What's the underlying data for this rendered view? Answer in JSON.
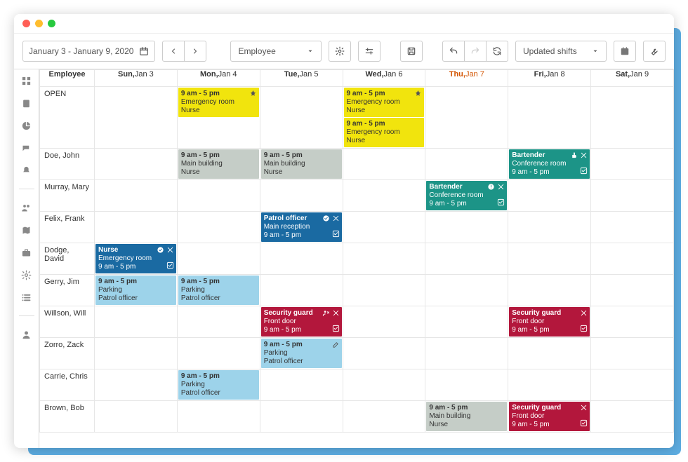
{
  "toolbar": {
    "date_range": "January 3 - January 9, 2020",
    "group_by": "Employee",
    "filter": "Updated shifts"
  },
  "header": {
    "employee_col": "Employee",
    "days": [
      {
        "dow": "Sun,",
        "date": "Jan 3"
      },
      {
        "dow": "Mon,",
        "date": "Jan 4"
      },
      {
        "dow": "Tue,",
        "date": "Jan 5"
      },
      {
        "dow": "Wed,",
        "date": "Jan 6"
      },
      {
        "dow": "Thu,",
        "date": "Jan 7",
        "today": true
      },
      {
        "dow": "Fri,",
        "date": "Jan 8"
      },
      {
        "dow": "Sat,",
        "date": "Jan 9"
      }
    ]
  },
  "rows": [
    {
      "name": "OPEN",
      "cells": [
        [],
        [
          {
            "t1": "9 am - 5 pm",
            "t2": "Emergency room",
            "t3": "Nurse",
            "color": "yellow",
            "icons": [
              "pin"
            ]
          }
        ],
        [],
        [
          {
            "t1": "9 am - 5 pm",
            "t2": "Emergency room",
            "t3": "Nurse",
            "color": "yellow",
            "icons": [
              "pin"
            ]
          },
          {
            "t1": "9 am - 5 pm",
            "t2": "Emergency room",
            "t3": "Nurse",
            "color": "yellow"
          }
        ],
        [],
        [],
        []
      ]
    },
    {
      "name": "Doe, John",
      "cells": [
        [],
        [
          {
            "t1": "9 am - 5 pm",
            "t2": "Main building",
            "t3": "Nurse",
            "color": "gray"
          }
        ],
        [
          {
            "t1": "9 am - 5 pm",
            "t2": "Main building",
            "t3": "Nurse",
            "color": "gray"
          }
        ],
        [],
        [],
        [
          {
            "t1": "Bartender",
            "t2": "Conference room",
            "t3": "9 am - 5 pm",
            "color": "teal",
            "icons": [
              "thumb",
              "close"
            ],
            "corner": "check"
          }
        ],
        []
      ]
    },
    {
      "name": "Murray, Mary",
      "cells": [
        [],
        [],
        [],
        [],
        [
          {
            "t1": "Bartender",
            "t2": "Conference room",
            "t3": "9 am - 5 pm",
            "color": "teal",
            "icons": [
              "alert",
              "close"
            ],
            "corner": "check"
          }
        ],
        [],
        []
      ]
    },
    {
      "name": "Felix, Frank",
      "cells": [
        [],
        [],
        [
          {
            "t1": "Patrol officer",
            "t2": "Main reception",
            "t3": "9 am - 5 pm",
            "color": "navy",
            "icons": [
              "okcircle",
              "close"
            ],
            "corner": "check"
          }
        ],
        [],
        [],
        [],
        []
      ]
    },
    {
      "name": "Dodge, David",
      "cells": [
        [
          {
            "t1": "Nurse",
            "t2": "Emergency room",
            "t3": "9 am - 5 pm",
            "color": "navy",
            "icons": [
              "okcircle",
              "close"
            ],
            "corner": "check"
          }
        ],
        [],
        [],
        [],
        [],
        [],
        []
      ]
    },
    {
      "name": "Gerry, Jim",
      "cells": [
        [
          {
            "t1": "9 am - 5 pm",
            "t2": "Parking",
            "t3": "Patrol officer",
            "color": "blue"
          }
        ],
        [
          {
            "t1": "9 am - 5 pm",
            "t2": "Parking",
            "t3": "Patrol officer",
            "color": "blue"
          }
        ],
        [],
        [],
        [],
        [],
        []
      ]
    },
    {
      "name": "Willson, Will",
      "cells": [
        [],
        [],
        [
          {
            "t1": "Security guard",
            "t2": "Front door",
            "t3": "9 am - 5 pm",
            "color": "red",
            "icons": [
              "userx",
              "close"
            ],
            "corner": "check"
          }
        ],
        [],
        [],
        [
          {
            "t1": "Security guard",
            "t2": "Front door",
            "t3": "9 am - 5 pm",
            "color": "red",
            "icons": [
              "close"
            ],
            "corner": "check"
          }
        ],
        []
      ]
    },
    {
      "name": "Zorro, Zack",
      "cells": [
        [],
        [],
        [
          {
            "t1": "9 am - 5 pm",
            "t2": "Parking",
            "t3": "Patrol officer",
            "color": "blue",
            "icons": [
              "edit"
            ]
          }
        ],
        [],
        [],
        [],
        []
      ]
    },
    {
      "name": "Carrie, Chris",
      "cells": [
        [],
        [
          {
            "t1": "9 am - 5 pm",
            "t2": "Parking",
            "t3": "Patrol officer",
            "color": "blue"
          }
        ],
        [],
        [],
        [],
        [],
        []
      ]
    },
    {
      "name": "Brown, Bob",
      "cells": [
        [],
        [],
        [],
        [],
        [
          {
            "t1": "9 am - 5 pm",
            "t2": "Main building",
            "t3": "Nurse",
            "color": "gray"
          }
        ],
        [
          {
            "t1": "Security guard",
            "t2": "Front door",
            "t3": "9 am - 5 pm",
            "color": "red",
            "icons": [
              "close"
            ],
            "corner": "check"
          }
        ],
        []
      ]
    }
  ]
}
